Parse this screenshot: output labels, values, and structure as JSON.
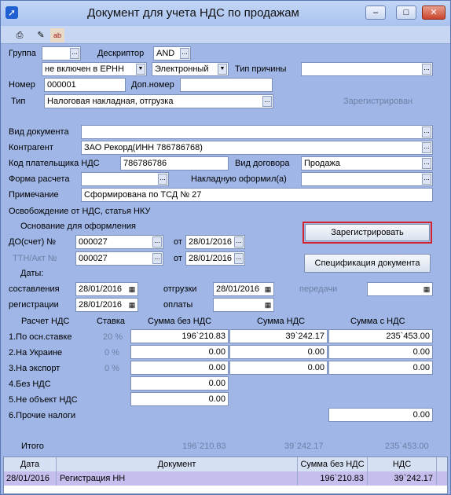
{
  "window": {
    "title": "Документ для учета НДС по продажам",
    "minimize": "‒",
    "maximize": "□",
    "close": "✕"
  },
  "toolbar": {
    "print_icon": "printer-icon",
    "edit_icon": "edit-icon",
    "spell_icon": "spell-icon",
    "spell_glyph": "ab"
  },
  "form": {
    "group_label": "Группа",
    "group_value": "",
    "descriptor_label": "Дескриптор",
    "descriptor_value": "AND",
    "erpn_value": "не включен в ЕРНН",
    "type_e_value": "Электронный",
    "reason_type_label": "Тип причины",
    "reason_type_value": "",
    "number_label": "Номер",
    "number_value": "000001",
    "extra_number_label": "Доп.номер",
    "extra_number_value": "",
    "type_label": "Тип",
    "type_value": "Налоговая накладная, отгрузка",
    "status_text": "Зарегистрирован",
    "doc_kind_label": "Вид документа",
    "doc_kind_value": "",
    "counterparty_label": "Контрагент",
    "counterparty_value": "ЗАО Рекорд(ИНН 786786768)",
    "vat_code_label": "Код плательщика НДС",
    "vat_code_value": "786786786",
    "contract_kind_label": "Вид договора",
    "contract_kind_value": "Продажа",
    "payment_form_label": "Форма расчета",
    "payment_form_value": "",
    "invoice_by_label": "Накладную оформил(а)",
    "invoice_by_value": "",
    "note_label": "Примечание",
    "note_value": "Сформирована по ТСД № 27",
    "exemption_label": "Освобождение от НДС, статья НКУ",
    "basis_label": "Основание для оформления",
    "do_label": "ДО(счет) №",
    "do_value": "000027",
    "do_from_label": "от",
    "do_date": "28/01/2016",
    "ttn_label": "ТТН/Акт №",
    "ttn_value": "000027",
    "ttn_from_label": "от",
    "ttn_date": "28/01/2016",
    "register_button": "Зарегистрировать",
    "spec_button": "Спецификация документа",
    "dates_label": "Даты:",
    "compose_label": "составления",
    "compose_date": "28/01/2016",
    "shipment_label": "отгрузки",
    "shipment_date": "28/01/2016",
    "transfer_label": "передачи",
    "transfer_date": "",
    "registration_label": "регистрации",
    "registration_date": "28/01/2016",
    "payment_label": "оплаты",
    "payment_date": ""
  },
  "vat_table": {
    "headers": {
      "calc": "Расчет НДС",
      "rate": "Ставка",
      "sum_wo": "Сумма без НДС",
      "vat": "Сумма НДС",
      "sum_w": "Сумма с НДС"
    },
    "rows": [
      {
        "label": "1.По осн.ставке",
        "rate": "20 %",
        "sum_wo": "196`210.83",
        "vat": "39`242.17",
        "sum_w": "235`453.00"
      },
      {
        "label": "2.На Украине",
        "rate": "0 %",
        "sum_wo": "0.00",
        "vat": "0.00",
        "sum_w": "0.00"
      },
      {
        "label": "3.На экспорт",
        "rate": "0 %",
        "sum_wo": "0.00",
        "vat": "0.00",
        "sum_w": "0.00"
      },
      {
        "label": "4.Без НДС",
        "sum_wo": "0.00"
      },
      {
        "label": "5.Не объект НДС",
        "sum_wo": "0.00"
      },
      {
        "label": "6.Прочие налоги",
        "sum_w": "0.00"
      }
    ],
    "total_label": "Итого",
    "total_wo": "196`210.83",
    "total_vat": "39`242.17",
    "total_w": "235`453.00"
  },
  "grid": {
    "headers": {
      "date": "Дата",
      "doc": "Документ",
      "sum_wo": "Сумма без НДС",
      "vat": "НДС"
    },
    "rows": [
      {
        "date": "28/01/2016",
        "doc": "Регистрация НН",
        "sum_wo": "196`210.83",
        "vat": "39`242.17"
      }
    ]
  },
  "colors": {
    "accent_highlight": "#d4232c",
    "window_bg": "#9fb6e6",
    "grid_selected": "#c6bfee"
  }
}
